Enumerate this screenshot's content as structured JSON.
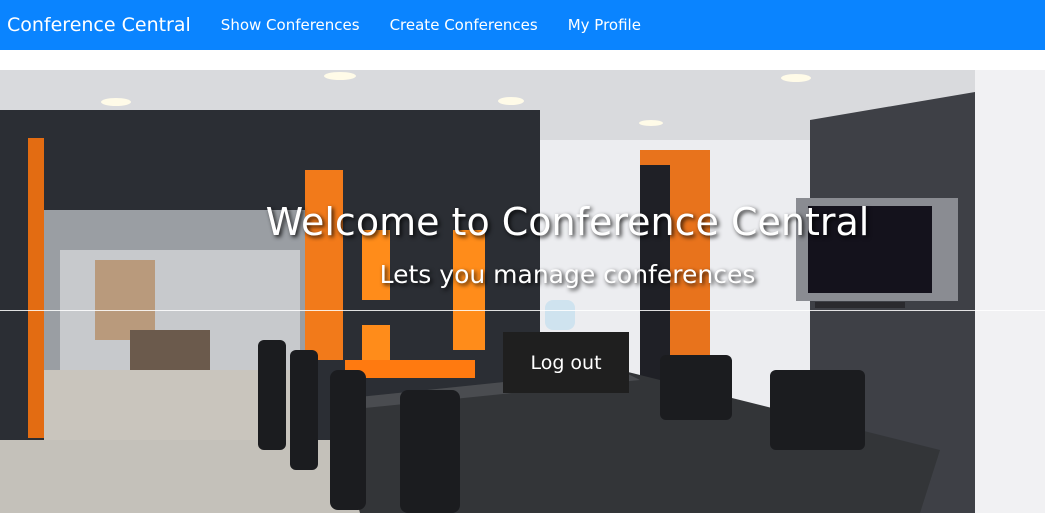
{
  "navbar": {
    "brand": "Conference Central",
    "links": [
      "Show Conferences",
      "Create Conferences",
      "My Profile"
    ]
  },
  "hero": {
    "title": "Welcome to Conference Central",
    "subtitle": "Lets you manage conferences",
    "logout_label": "Log out",
    "background": "conference-room-photo"
  },
  "colors": {
    "navbar": "#0a84ff",
    "button": "#1f1f1f",
    "accent_orange": "#f27a1a"
  }
}
